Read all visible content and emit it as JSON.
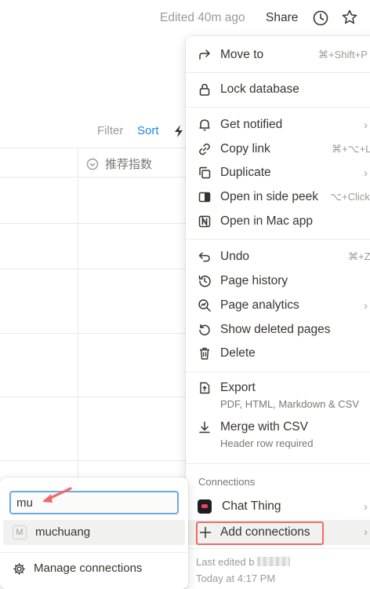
{
  "topbar": {
    "edited": "Edited 40m ago",
    "share": "Share",
    "icons": [
      "clock-icon",
      "star-icon"
    ]
  },
  "view": {
    "filter": "Filter",
    "sort": "Sort",
    "sort_color": "#2383e2"
  },
  "table": {
    "column_header": "推荐指数"
  },
  "menu": {
    "items": [
      {
        "label": "Move to",
        "shortcut": "⌘+Shift+P",
        "icon": "arrow-turn-icon"
      },
      {
        "label": "Lock database",
        "icon": "lock-icon"
      },
      {
        "label": "Get notified",
        "icon": "bell-icon",
        "submenu": true
      },
      {
        "label": "Copy link",
        "shortcut": "⌘+⌥+L",
        "icon": "link-icon"
      },
      {
        "label": "Duplicate",
        "icon": "duplicate-icon",
        "submenu": true
      },
      {
        "label": "Open in side peek",
        "shortcut": "⌥+Click",
        "icon": "side-peek-icon"
      },
      {
        "label": "Open in Mac app",
        "icon": "notion-app-icon"
      },
      {
        "label": "Undo",
        "shortcut": "⌘+Z",
        "icon": "undo-icon"
      },
      {
        "label": "Page history",
        "icon": "history-icon"
      },
      {
        "label": "Page analytics",
        "icon": "analytics-icon",
        "submenu": true
      },
      {
        "label": "Show deleted pages",
        "icon": "restore-icon"
      },
      {
        "label": "Delete",
        "icon": "trash-icon"
      },
      {
        "label": "Export",
        "sublabel": "PDF, HTML, Markdown & CSV",
        "icon": "export-icon"
      },
      {
        "label": "Merge with CSV",
        "sublabel": "Header row required",
        "icon": "merge-icon"
      }
    ],
    "connections_title": "Connections",
    "connections": [
      {
        "label": "Chat Thing",
        "icon": "chat-thing-icon",
        "submenu": true
      },
      {
        "label": "Add connections",
        "icon": "plus-icon",
        "submenu": true,
        "highlight_color": "#ef6b6b"
      }
    ],
    "last_edited": "Last edited b",
    "last_edited_time": "Today at 4:17 PM"
  },
  "connection_search": {
    "query": "mu",
    "results": [
      {
        "label": "muchuang",
        "icon": "M"
      }
    ],
    "manage": "Manage connections",
    "focus_color": "#6aaae4",
    "arrow_color": "#ef6b6b"
  }
}
